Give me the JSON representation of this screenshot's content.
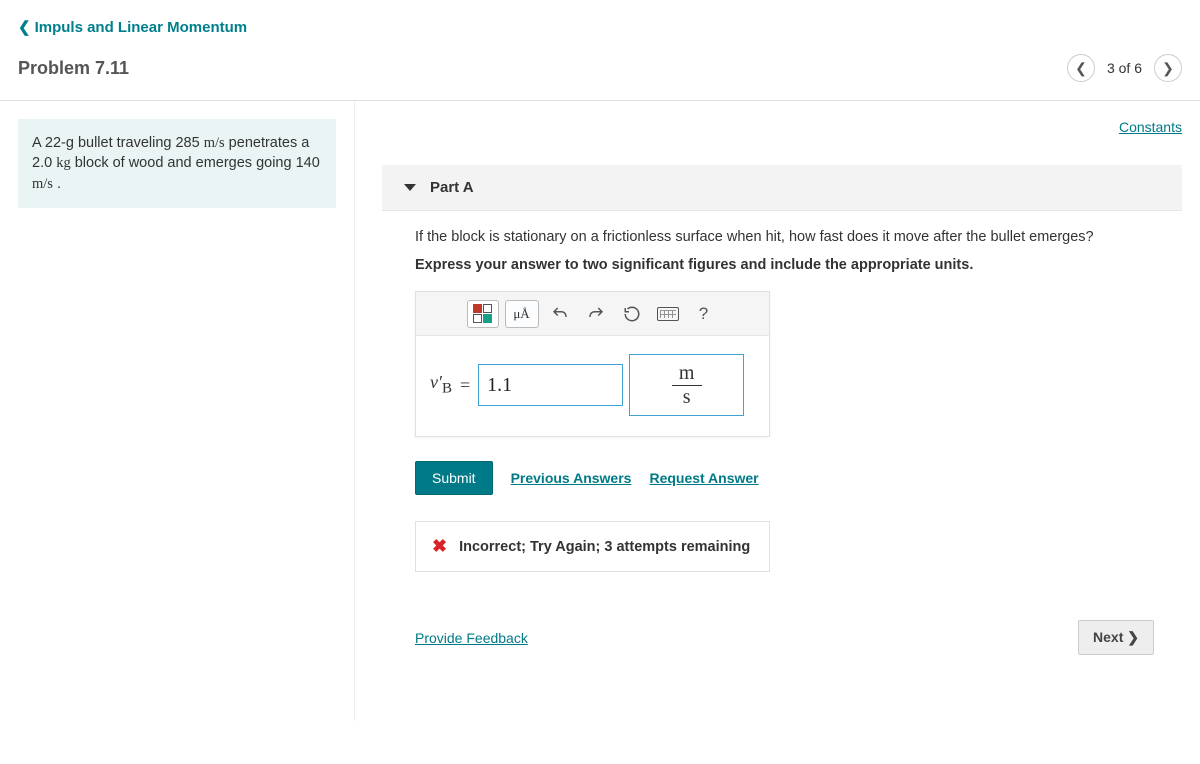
{
  "breadcrumb": {
    "label": "Impuls and Linear Momentum"
  },
  "title": "Problem 7.11",
  "pager": {
    "text": "3 of 6"
  },
  "constants_label": "Constants",
  "problem": {
    "line1_a": "A 22-g bullet traveling 285 ",
    "line1_speed": "m/s",
    "line1_b": " penetrates a 2.0 ",
    "line1_kg": "kg",
    "line1_c": " block of wood and emerges going 140 ",
    "line1_speed2": "m/s",
    "line1_d": " ."
  },
  "part": {
    "label": "Part A",
    "question": "If the block is stationary on a frictionless surface when hit, how fast does it move after the bullet emerges?",
    "instruction": "Express your answer to two significant figures and include the appropriate units."
  },
  "answer": {
    "var_html": "v'_B",
    "value": "1.1",
    "unit_num": "m",
    "unit_den": "s"
  },
  "toolbar": {
    "units_label": "μÅ",
    "help": "?"
  },
  "actions": {
    "submit": "Submit",
    "previous": "Previous Answers",
    "request": "Request Answer"
  },
  "feedback": "Incorrect; Try Again; 3 attempts remaining",
  "provide_feedback": "Provide Feedback",
  "next": "Next ❯"
}
